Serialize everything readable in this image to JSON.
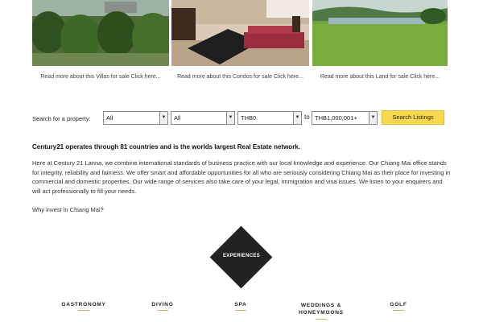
{
  "listings": [
    {
      "caption": "Read more about this Villas for sale Click here..."
    },
    {
      "caption": "Read more about this Condos for sale Click here..."
    },
    {
      "caption": "Read more about this Land for sale Click here..."
    }
  ],
  "search": {
    "label": "Search for a property:",
    "type_value": "All",
    "location_value": "All",
    "min_price_value": "THB0",
    "to_label": "to",
    "max_price_value": "THB1,000,001+",
    "button_label": "Search Listings",
    "button_color": "#f7d84e"
  },
  "intro": {
    "headline": "Century21 operates through 81 countries and is the worlds largest Real Estate network.",
    "body": "Here at Century 21 Lanna, we combine international standards of business practice with our local knowledge and experience. Our Chiang Mai office stands for integrity, reliability and fairness. We offer smart and affordable opportunities for all who are seriously considering Chiang Mai as their place for investing in commercial and domestic properties. Our wide range of services also take care of your legal, immigration and visa issues. We listen to your enquirers and will act professionally to fill your needs.",
    "why_link": "Why invest in Chiang Mai?"
  },
  "experiences": {
    "title": "EXPERIENCES",
    "categories": [
      "GASTRONOMY",
      "DIVING",
      "SPA",
      "WEDDINGS & HONEYMOONS",
      "GOLF"
    ]
  }
}
